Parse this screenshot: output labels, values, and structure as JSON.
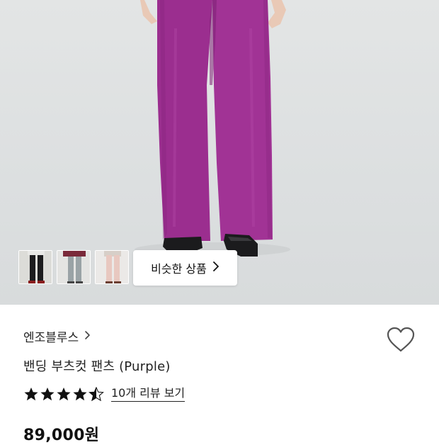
{
  "hero": {
    "thumbnails": [
      {
        "label": "thumb-black-pants"
      },
      {
        "label": "thumb-grey-pants"
      },
      {
        "label": "thumb-pink-pants"
      }
    ],
    "similar_button_label": "비슷한 상품",
    "similar_button_icon": "chevron-right-icon"
  },
  "product": {
    "brand": "엔조블루스",
    "brand_chevron": "›",
    "title": "밴딩 부츠컷 팬츠 (Purple)",
    "rating": 4.5,
    "rating_max": 5,
    "review_link": "10개 리뷰 보기",
    "price": "89,000원",
    "wishlist_icon": "heart-icon"
  },
  "colors": {
    "pants": "#9b2e8f",
    "background": "#dfe2e3",
    "star": "#111111"
  }
}
